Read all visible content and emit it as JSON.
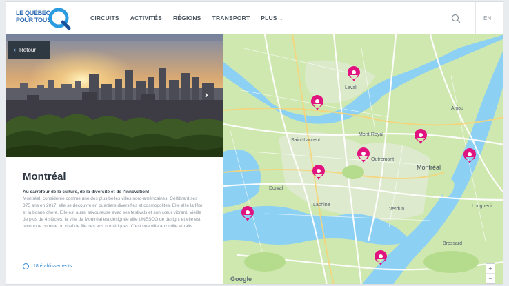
{
  "header": {
    "logo_line1": "LE QUÉBEC",
    "logo_line2": "POUR TOUS",
    "nav": [
      "CIRCUITS",
      "ACTIVITÉS",
      "RÉGIONS",
      "TRANSPORT",
      "PLUS"
    ],
    "lang": "EN"
  },
  "panel": {
    "back_label": "Retour",
    "title": "Montréal",
    "lead": "Au carrefour de la culture, de la diversité et de l'innovation!",
    "body": "Montréal, considérée comme une des plus belles villes nord-américaines. Célébrant ses 375 ans en 2017, elle se découvre en quartiers diversifiés et cosmopolites. Elle allie la fête et la bonne chère. Elle est aussi savoureuse avec ses festivals et son cœur vibrant. Vieille de plus de 4 siècles, la ville de Montréal est désignée ville UNESCO de design, et elle est reconnue comme un chef de file des arts numériques. C'est une ville aux mille attraits.",
    "link": "18 établissements"
  },
  "map": {
    "labels": {
      "laval": "Laval",
      "montreal": "Montréal",
      "longueuil": "Longueuil",
      "brossard": "Brossard",
      "verdun": "Verdun",
      "dorval": "Dorval",
      "lachine": "Lachine",
      "outremont": "Outremont",
      "stlaurent": "Saint-Laurent",
      "anjou": "Anjou",
      "montroyal": "Mont-Royal"
    },
    "attribution": "Google",
    "zoom_in": "+",
    "zoom_out": "−",
    "pin_color": "#e0137f",
    "water_color": "#8cd0f4",
    "land_color": "#cfe8b0"
  }
}
